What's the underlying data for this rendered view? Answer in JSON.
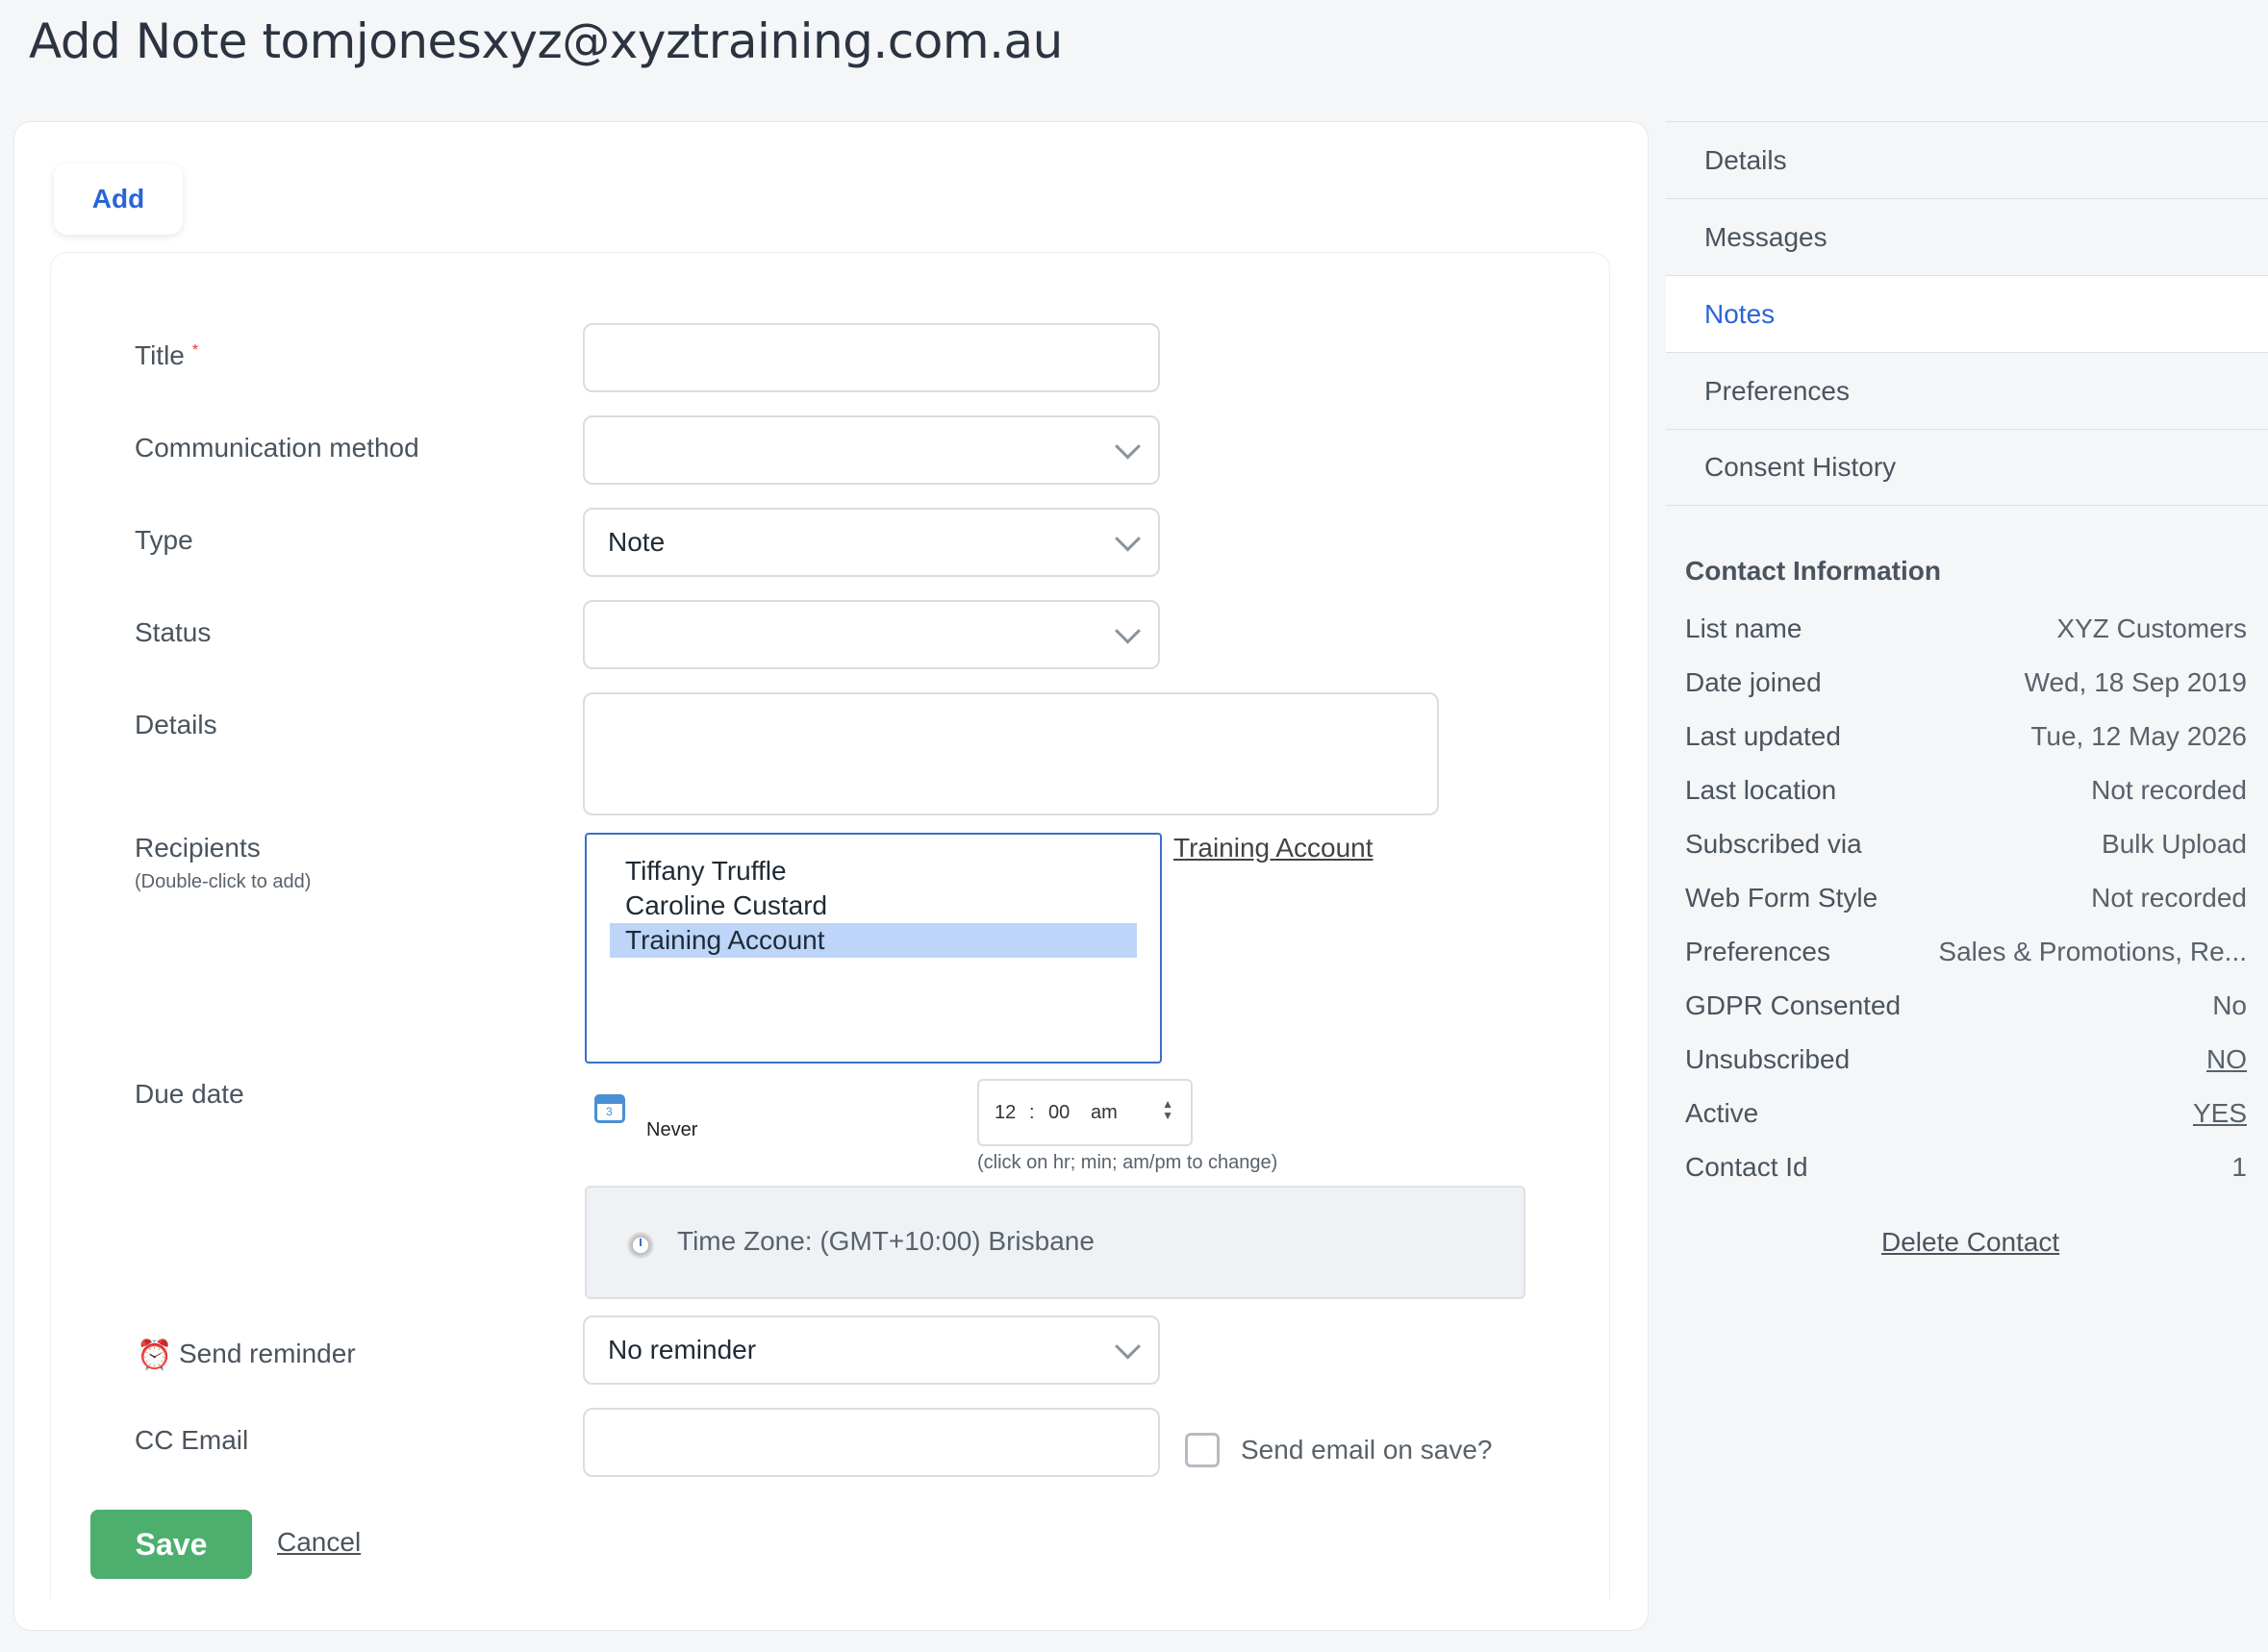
{
  "page": {
    "title": "Add Note tomjonesxyz@xyztraining.com.au"
  },
  "tabs": {
    "add": "Add"
  },
  "form": {
    "title_label": "Title",
    "title_required_mark": "*",
    "title_value": "",
    "comm_method_label": "Communication method",
    "comm_method_value": "",
    "type_label": "Type",
    "type_value": "Note",
    "status_label": "Status",
    "status_value": "",
    "details_label": "Details",
    "details_value": "",
    "recipients_label": "Recipients",
    "recipients_hint": "(Double-click to add)",
    "recipients_options": [
      "Tiffany Truffle",
      "Caroline Custard",
      "Training Account"
    ],
    "recipients_selected": "Training Account",
    "recipients_link": "Training Account",
    "due_date_label": "Due date",
    "due_date_cal_day": "3",
    "due_date_value": "Never",
    "time_hour": "12",
    "time_sep": ":",
    "time_min": "00",
    "time_ampm": "am",
    "time_hint": "(click on hr; min; am/pm to change)",
    "timezone_text": "Time Zone: (GMT+10:00) Brisbane",
    "reminder_label": "Send reminder",
    "reminder_value": "No reminder",
    "cc_label": "CC Email",
    "cc_value": "",
    "send_email_label": "Send email on save?",
    "save_label": "Save",
    "cancel_label": "Cancel"
  },
  "sidebar": {
    "items": [
      {
        "label": "Details",
        "active": false
      },
      {
        "label": "Messages",
        "active": false
      },
      {
        "label": "Notes",
        "active": true
      },
      {
        "label": "Preferences",
        "active": false
      },
      {
        "label": "Consent History",
        "active": false
      }
    ]
  },
  "contact_info": {
    "title": "Contact Information",
    "rows": [
      {
        "key": "List name",
        "value": "XYZ Customers"
      },
      {
        "key": "Date joined",
        "value": "Wed, 18 Sep 2019"
      },
      {
        "key": "Last updated",
        "value": "Tue, 12 May 2026"
      },
      {
        "key": "Last location",
        "value": "Not recorded"
      },
      {
        "key": "Subscribed via",
        "value": "Bulk Upload"
      },
      {
        "key": "Web Form Style",
        "value": "Not recorded"
      },
      {
        "key": "Preferences",
        "value": "Sales & Promotions, Re..."
      },
      {
        "key": "GDPR Consented",
        "value": "No"
      },
      {
        "key": "Unsubscribed",
        "value": "NO"
      },
      {
        "key": "Active",
        "value": "YES"
      },
      {
        "key": "Contact Id",
        "value": "1"
      }
    ],
    "delete_link": "Delete Contact"
  },
  "colors": {
    "accent": "#2a64d6",
    "save_button": "#4caf6e",
    "selected_option": "#bcd5f8"
  }
}
